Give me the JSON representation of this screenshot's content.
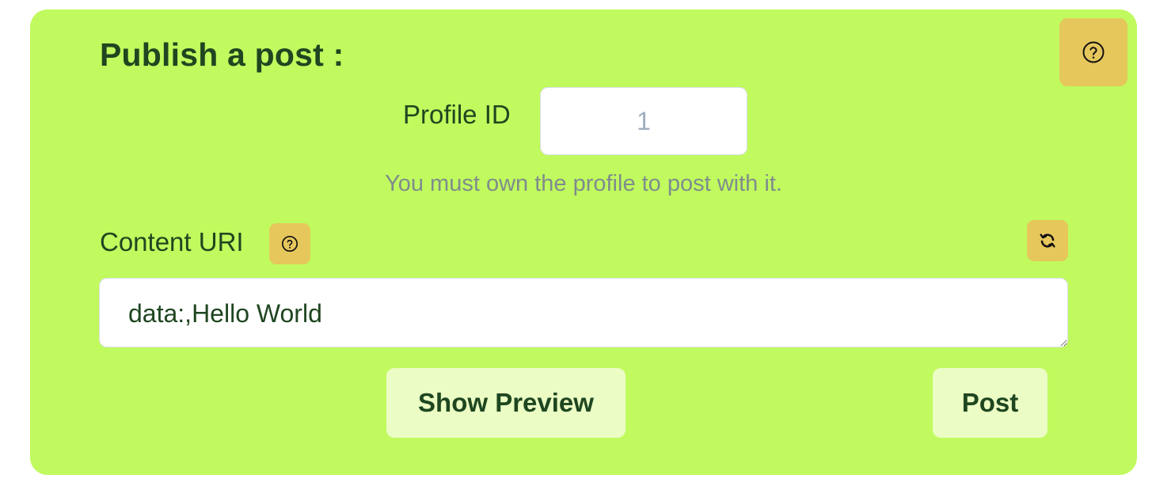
{
  "form": {
    "title": "Publish a post :",
    "help_icon": "question-circle-icon",
    "profile": {
      "label": "Profile ID",
      "placeholder": "1",
      "value": "",
      "hint": "You must own the profile to post with it."
    },
    "content": {
      "label": "Content URI",
      "help_icon": "question-circle-icon",
      "refresh_icon": "refresh-icon",
      "value": "data:,Hello World"
    },
    "buttons": {
      "preview_label": "Show Preview",
      "post_label": "Post"
    }
  },
  "colors": {
    "card_background": "#c0fa5e",
    "accent_button": "#e6c75c",
    "soft_button": "#ebfcc4",
    "text": "#1e4620",
    "hint_text": "#7f8c8d"
  }
}
